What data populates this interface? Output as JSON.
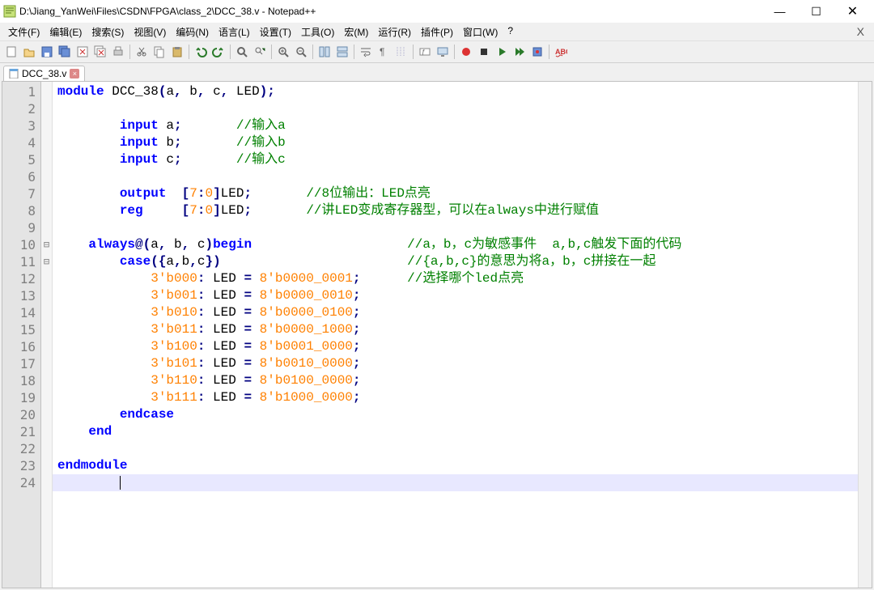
{
  "title": "D:\\Jiang_YanWei\\Files\\CSDN\\FPGA\\class_2\\DCC_38.v - Notepad++",
  "window": {
    "min": "—",
    "max": "☐",
    "close": "✕",
    "menu_close": "X"
  },
  "menu": {
    "file": "文件(F)",
    "edit": "编辑(E)",
    "search": "搜索(S)",
    "view": "视图(V)",
    "encoding": "编码(N)",
    "language": "语言(L)",
    "settings": "设置(T)",
    "tools": "工具(O)",
    "macro": "宏(M)",
    "run": "运行(R)",
    "plugins": "插件(P)",
    "window": "窗口(W)",
    "help": "?"
  },
  "tab": {
    "label": "DCC_38.v",
    "close": "×"
  },
  "code": {
    "lines": [
      {
        "n": 1,
        "fold": "",
        "t": [
          {
            "c": "kw",
            "s": "module"
          },
          {
            "c": "id",
            "s": " DCC_38"
          },
          {
            "c": "op",
            "s": "("
          },
          {
            "c": "id",
            "s": "a"
          },
          {
            "c": "op",
            "s": ","
          },
          {
            "c": "id",
            "s": " b"
          },
          {
            "c": "op",
            "s": ","
          },
          {
            "c": "id",
            "s": " c"
          },
          {
            "c": "op",
            "s": ","
          },
          {
            "c": "id",
            "s": " LED"
          },
          {
            "c": "op",
            "s": ");"
          }
        ]
      },
      {
        "n": 2,
        "fold": "",
        "t": []
      },
      {
        "n": 3,
        "fold": "",
        "t": [
          {
            "c": "id",
            "s": "        "
          },
          {
            "c": "kw",
            "s": "input"
          },
          {
            "c": "id",
            "s": " a"
          },
          {
            "c": "op",
            "s": ";"
          },
          {
            "c": "id",
            "s": "       "
          },
          {
            "c": "cmt",
            "s": "//输入a"
          }
        ]
      },
      {
        "n": 4,
        "fold": "",
        "t": [
          {
            "c": "id",
            "s": "        "
          },
          {
            "c": "kw",
            "s": "input"
          },
          {
            "c": "id",
            "s": " b"
          },
          {
            "c": "op",
            "s": ";"
          },
          {
            "c": "id",
            "s": "       "
          },
          {
            "c": "cmt",
            "s": "//输入b"
          }
        ]
      },
      {
        "n": 5,
        "fold": "",
        "t": [
          {
            "c": "id",
            "s": "        "
          },
          {
            "c": "kw",
            "s": "input"
          },
          {
            "c": "id",
            "s": " c"
          },
          {
            "c": "op",
            "s": ";"
          },
          {
            "c": "id",
            "s": "       "
          },
          {
            "c": "cmt",
            "s": "//输入c"
          }
        ]
      },
      {
        "n": 6,
        "fold": "",
        "t": []
      },
      {
        "n": 7,
        "fold": "",
        "t": [
          {
            "c": "id",
            "s": "        "
          },
          {
            "c": "kw",
            "s": "output"
          },
          {
            "c": "id",
            "s": "  "
          },
          {
            "c": "op",
            "s": "["
          },
          {
            "c": "num",
            "s": "7"
          },
          {
            "c": "op",
            "s": ":"
          },
          {
            "c": "num",
            "s": "0"
          },
          {
            "c": "op",
            "s": "]"
          },
          {
            "c": "id",
            "s": "LED"
          },
          {
            "c": "op",
            "s": ";"
          },
          {
            "c": "id",
            "s": "       "
          },
          {
            "c": "cmt",
            "s": "//8位输出：LED点亮"
          }
        ]
      },
      {
        "n": 8,
        "fold": "",
        "t": [
          {
            "c": "id",
            "s": "        "
          },
          {
            "c": "kw",
            "s": "reg"
          },
          {
            "c": "id",
            "s": "     "
          },
          {
            "c": "op",
            "s": "["
          },
          {
            "c": "num",
            "s": "7"
          },
          {
            "c": "op",
            "s": ":"
          },
          {
            "c": "num",
            "s": "0"
          },
          {
            "c": "op",
            "s": "]"
          },
          {
            "c": "id",
            "s": "LED"
          },
          {
            "c": "op",
            "s": ";"
          },
          {
            "c": "id",
            "s": "       "
          },
          {
            "c": "cmt",
            "s": "//讲LED变成寄存器型，可以在always中进行赋值"
          }
        ]
      },
      {
        "n": 9,
        "fold": "",
        "t": []
      },
      {
        "n": 10,
        "fold": "⊟",
        "t": [
          {
            "c": "id",
            "s": "    "
          },
          {
            "c": "kw",
            "s": "always"
          },
          {
            "c": "op",
            "s": "@("
          },
          {
            "c": "id",
            "s": "a"
          },
          {
            "c": "op",
            "s": ","
          },
          {
            "c": "id",
            "s": " b"
          },
          {
            "c": "op",
            "s": ","
          },
          {
            "c": "id",
            "s": " c"
          },
          {
            "c": "op",
            "s": ")"
          },
          {
            "c": "kw",
            "s": "begin"
          },
          {
            "c": "id",
            "s": "                    "
          },
          {
            "c": "cmt",
            "s": "//a，b，c为敏感事件  a,b,c触发下面的代码"
          }
        ]
      },
      {
        "n": 11,
        "fold": "⊟",
        "t": [
          {
            "c": "id",
            "s": "        "
          },
          {
            "c": "kw",
            "s": "case"
          },
          {
            "c": "op",
            "s": "({"
          },
          {
            "c": "id",
            "s": "a"
          },
          {
            "c": "op",
            "s": ","
          },
          {
            "c": "id",
            "s": "b"
          },
          {
            "c": "op",
            "s": ","
          },
          {
            "c": "id",
            "s": "c"
          },
          {
            "c": "op",
            "s": "})"
          },
          {
            "c": "id",
            "s": "                        "
          },
          {
            "c": "cmt",
            "s": "//{a,b,c}的意思为将a，b，c拼接在一起"
          }
        ]
      },
      {
        "n": 12,
        "fold": "",
        "t": [
          {
            "c": "id",
            "s": "            "
          },
          {
            "c": "num",
            "s": "3'b000"
          },
          {
            "c": "op",
            "s": ":"
          },
          {
            "c": "id",
            "s": " LED "
          },
          {
            "c": "op",
            "s": "="
          },
          {
            "c": "id",
            "s": " "
          },
          {
            "c": "num",
            "s": "8'b0000_0001"
          },
          {
            "c": "op",
            "s": ";"
          },
          {
            "c": "id",
            "s": "      "
          },
          {
            "c": "cmt",
            "s": "//选择哪个led点亮"
          }
        ]
      },
      {
        "n": 13,
        "fold": "",
        "t": [
          {
            "c": "id",
            "s": "            "
          },
          {
            "c": "num",
            "s": "3'b001"
          },
          {
            "c": "op",
            "s": ":"
          },
          {
            "c": "id",
            "s": " LED "
          },
          {
            "c": "op",
            "s": "="
          },
          {
            "c": "id",
            "s": " "
          },
          {
            "c": "num",
            "s": "8'b0000_0010"
          },
          {
            "c": "op",
            "s": ";"
          }
        ]
      },
      {
        "n": 14,
        "fold": "",
        "t": [
          {
            "c": "id",
            "s": "            "
          },
          {
            "c": "num",
            "s": "3'b010"
          },
          {
            "c": "op",
            "s": ":"
          },
          {
            "c": "id",
            "s": " LED "
          },
          {
            "c": "op",
            "s": "="
          },
          {
            "c": "id",
            "s": " "
          },
          {
            "c": "num",
            "s": "8'b0000_0100"
          },
          {
            "c": "op",
            "s": ";"
          }
        ]
      },
      {
        "n": 15,
        "fold": "",
        "t": [
          {
            "c": "id",
            "s": "            "
          },
          {
            "c": "num",
            "s": "3'b011"
          },
          {
            "c": "op",
            "s": ":"
          },
          {
            "c": "id",
            "s": " LED "
          },
          {
            "c": "op",
            "s": "="
          },
          {
            "c": "id",
            "s": " "
          },
          {
            "c": "num",
            "s": "8'b0000_1000"
          },
          {
            "c": "op",
            "s": ";"
          }
        ]
      },
      {
        "n": 16,
        "fold": "",
        "t": [
          {
            "c": "id",
            "s": "            "
          },
          {
            "c": "num",
            "s": "3'b100"
          },
          {
            "c": "op",
            "s": ":"
          },
          {
            "c": "id",
            "s": " LED "
          },
          {
            "c": "op",
            "s": "="
          },
          {
            "c": "id",
            "s": " "
          },
          {
            "c": "num",
            "s": "8'b0001_0000"
          },
          {
            "c": "op",
            "s": ";"
          }
        ]
      },
      {
        "n": 17,
        "fold": "",
        "t": [
          {
            "c": "id",
            "s": "            "
          },
          {
            "c": "num",
            "s": "3'b101"
          },
          {
            "c": "op",
            "s": ":"
          },
          {
            "c": "id",
            "s": " LED "
          },
          {
            "c": "op",
            "s": "="
          },
          {
            "c": "id",
            "s": " "
          },
          {
            "c": "num",
            "s": "8'b0010_0000"
          },
          {
            "c": "op",
            "s": ";"
          }
        ]
      },
      {
        "n": 18,
        "fold": "",
        "t": [
          {
            "c": "id",
            "s": "            "
          },
          {
            "c": "num",
            "s": "3'b110"
          },
          {
            "c": "op",
            "s": ":"
          },
          {
            "c": "id",
            "s": " LED "
          },
          {
            "c": "op",
            "s": "="
          },
          {
            "c": "id",
            "s": " "
          },
          {
            "c": "num",
            "s": "8'b0100_0000"
          },
          {
            "c": "op",
            "s": ";"
          }
        ]
      },
      {
        "n": 19,
        "fold": "",
        "t": [
          {
            "c": "id",
            "s": "            "
          },
          {
            "c": "num",
            "s": "3'b111"
          },
          {
            "c": "op",
            "s": ":"
          },
          {
            "c": "id",
            "s": " LED "
          },
          {
            "c": "op",
            "s": "="
          },
          {
            "c": "id",
            "s": " "
          },
          {
            "c": "num",
            "s": "8'b1000_0000"
          },
          {
            "c": "op",
            "s": ";"
          }
        ]
      },
      {
        "n": 20,
        "fold": "",
        "t": [
          {
            "c": "id",
            "s": "        "
          },
          {
            "c": "kw",
            "s": "endcase"
          }
        ]
      },
      {
        "n": 21,
        "fold": "",
        "t": [
          {
            "c": "id",
            "s": "    "
          },
          {
            "c": "kw",
            "s": "end"
          }
        ]
      },
      {
        "n": 22,
        "fold": "",
        "t": []
      },
      {
        "n": 23,
        "fold": "",
        "t": [
          {
            "c": "kw",
            "s": "endmodule"
          }
        ]
      },
      {
        "n": 24,
        "fold": "",
        "t": [],
        "current": true
      }
    ]
  },
  "toolbar_icons": [
    "new-file",
    "open-file",
    "save-file",
    "save-all",
    "close-file",
    "close-all",
    "print",
    "sep",
    "cut",
    "copy",
    "paste",
    "sep",
    "undo",
    "redo",
    "sep",
    "find",
    "replace",
    "sep",
    "zoom-in",
    "zoom-out",
    "sep",
    "sync-v",
    "sync-h",
    "sep",
    "wrap",
    "all-chars",
    "indent-guide",
    "sep",
    "lang",
    "monitor",
    "sep",
    "macro-rec",
    "macro-stop",
    "macro-play",
    "macro-play-multi",
    "macro-save",
    "sep",
    "spell-check"
  ]
}
